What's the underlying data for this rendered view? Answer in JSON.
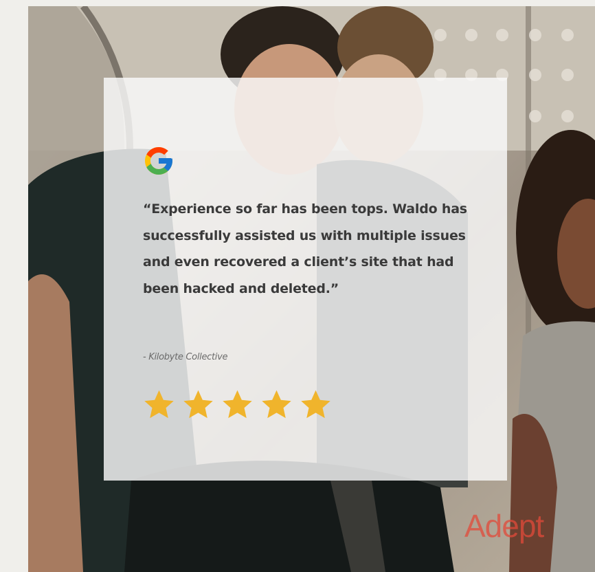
{
  "icons": {
    "logo": "google-g-icon",
    "star": "star-icon"
  },
  "review": {
    "quote": "“Experience so far has been tops. Waldo has successfully assisted us with multiple issues and even recovered a client’s site that had been hacked and deleted.”",
    "author": "- Kilobyte Collective",
    "rating": 5,
    "rating_max": 5
  },
  "brand": {
    "name": "Adept"
  },
  "colors": {
    "star": "#f0b42c",
    "card": "#fafafa",
    "text": "#3a3a3a",
    "brand": "#e24a3a",
    "page_bg": "#f0efeb"
  }
}
